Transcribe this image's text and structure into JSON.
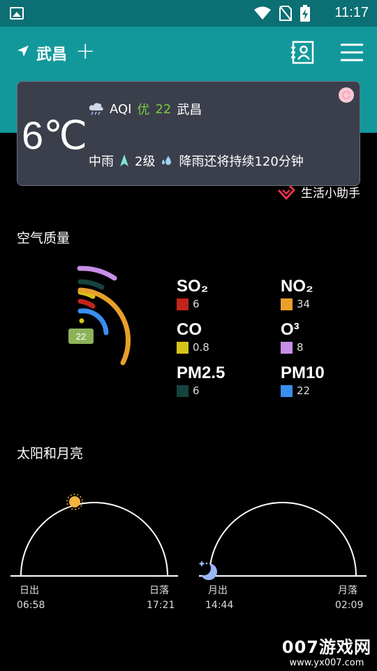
{
  "status_bar": {
    "time": "11:17"
  },
  "header": {
    "city": "武昌",
    "add_symbol": "+"
  },
  "weather_card": {
    "temperature": "6℃",
    "aqi_label": "AQI",
    "aqi_quality": "优",
    "aqi_value": "22",
    "location": "武昌",
    "condition": "中雨",
    "wind_level": "2级",
    "rain_forecast": "降雨还将持续120分钟"
  },
  "assistant_label": "生活小助手",
  "air_quality": {
    "title": "空气质量",
    "aqi_badge": "22",
    "pollutants": [
      {
        "name": "SO₂",
        "value": "6",
        "color": "#c0241c"
      },
      {
        "name": "NO₂",
        "value": "34",
        "color": "#e8a02a"
      },
      {
        "name": "CO",
        "value": "0.8",
        "color": "#d6c319"
      },
      {
        "name": "O³",
        "value": "8",
        "color": "#c88ee8"
      },
      {
        "name": "PM2.5",
        "value": "6",
        "color": "#16433f"
      },
      {
        "name": "PM10",
        "value": "22",
        "color": "#3a8ef0"
      }
    ]
  },
  "sun_moon": {
    "title": "太阳和月亮",
    "sunrise_label": "日出",
    "sunrise_time": "06:58",
    "sunset_label": "日落",
    "sunset_time": "17:21",
    "moonrise_label": "月出",
    "moonrise_time": "14:44",
    "moonset_label": "月落",
    "moonset_time": "02:09"
  },
  "watermark": {
    "title": "007游戏网",
    "url": "www.yx007.com"
  },
  "colors": {
    "header": "#12989b",
    "status_bar": "#0b6f73",
    "card": "#3b3f4b",
    "accent_green": "#7ac943"
  }
}
